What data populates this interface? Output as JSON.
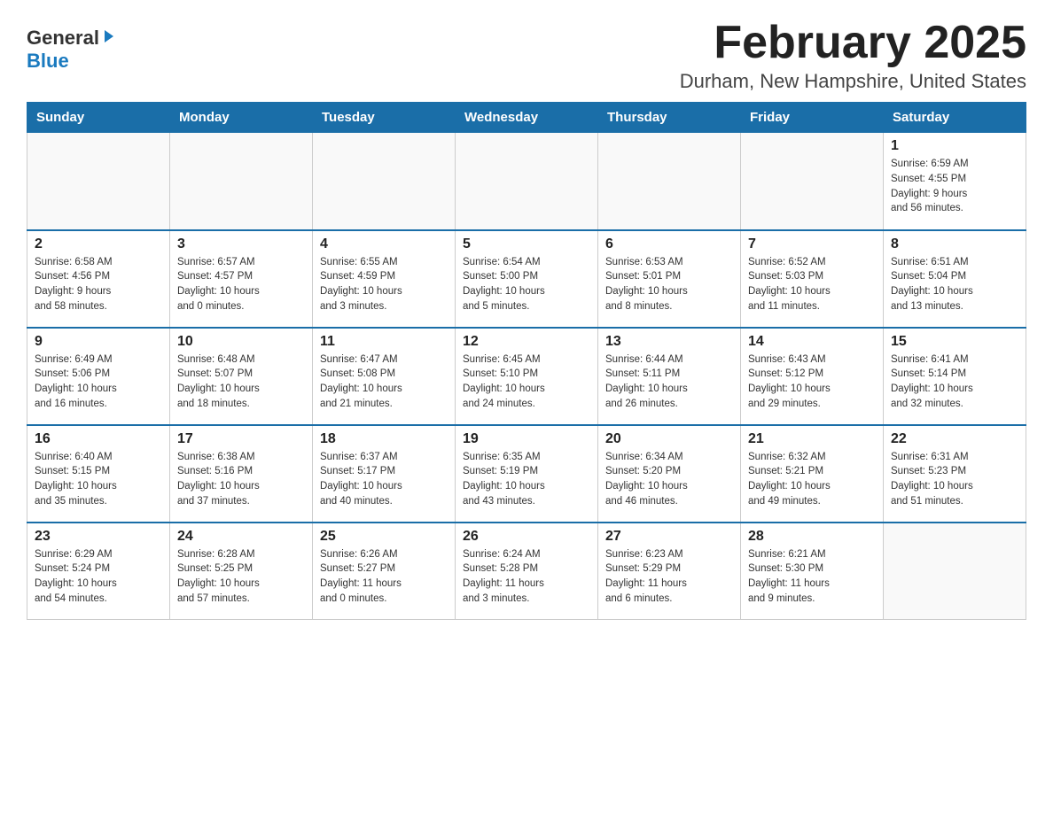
{
  "header": {
    "logo_general": "General",
    "logo_blue": "Blue",
    "month_title": "February 2025",
    "location": "Durham, New Hampshire, United States"
  },
  "days_of_week": [
    "Sunday",
    "Monday",
    "Tuesday",
    "Wednesday",
    "Thursday",
    "Friday",
    "Saturday"
  ],
  "weeks": [
    [
      {
        "day": "",
        "info": ""
      },
      {
        "day": "",
        "info": ""
      },
      {
        "day": "",
        "info": ""
      },
      {
        "day": "",
        "info": ""
      },
      {
        "day": "",
        "info": ""
      },
      {
        "day": "",
        "info": ""
      },
      {
        "day": "1",
        "info": "Sunrise: 6:59 AM\nSunset: 4:55 PM\nDaylight: 9 hours\nand 56 minutes."
      }
    ],
    [
      {
        "day": "2",
        "info": "Sunrise: 6:58 AM\nSunset: 4:56 PM\nDaylight: 9 hours\nand 58 minutes."
      },
      {
        "day": "3",
        "info": "Sunrise: 6:57 AM\nSunset: 4:57 PM\nDaylight: 10 hours\nand 0 minutes."
      },
      {
        "day": "4",
        "info": "Sunrise: 6:55 AM\nSunset: 4:59 PM\nDaylight: 10 hours\nand 3 minutes."
      },
      {
        "day": "5",
        "info": "Sunrise: 6:54 AM\nSunset: 5:00 PM\nDaylight: 10 hours\nand 5 minutes."
      },
      {
        "day": "6",
        "info": "Sunrise: 6:53 AM\nSunset: 5:01 PM\nDaylight: 10 hours\nand 8 minutes."
      },
      {
        "day": "7",
        "info": "Sunrise: 6:52 AM\nSunset: 5:03 PM\nDaylight: 10 hours\nand 11 minutes."
      },
      {
        "day": "8",
        "info": "Sunrise: 6:51 AM\nSunset: 5:04 PM\nDaylight: 10 hours\nand 13 minutes."
      }
    ],
    [
      {
        "day": "9",
        "info": "Sunrise: 6:49 AM\nSunset: 5:06 PM\nDaylight: 10 hours\nand 16 minutes."
      },
      {
        "day": "10",
        "info": "Sunrise: 6:48 AM\nSunset: 5:07 PM\nDaylight: 10 hours\nand 18 minutes."
      },
      {
        "day": "11",
        "info": "Sunrise: 6:47 AM\nSunset: 5:08 PM\nDaylight: 10 hours\nand 21 minutes."
      },
      {
        "day": "12",
        "info": "Sunrise: 6:45 AM\nSunset: 5:10 PM\nDaylight: 10 hours\nand 24 minutes."
      },
      {
        "day": "13",
        "info": "Sunrise: 6:44 AM\nSunset: 5:11 PM\nDaylight: 10 hours\nand 26 minutes."
      },
      {
        "day": "14",
        "info": "Sunrise: 6:43 AM\nSunset: 5:12 PM\nDaylight: 10 hours\nand 29 minutes."
      },
      {
        "day": "15",
        "info": "Sunrise: 6:41 AM\nSunset: 5:14 PM\nDaylight: 10 hours\nand 32 minutes."
      }
    ],
    [
      {
        "day": "16",
        "info": "Sunrise: 6:40 AM\nSunset: 5:15 PM\nDaylight: 10 hours\nand 35 minutes."
      },
      {
        "day": "17",
        "info": "Sunrise: 6:38 AM\nSunset: 5:16 PM\nDaylight: 10 hours\nand 37 minutes."
      },
      {
        "day": "18",
        "info": "Sunrise: 6:37 AM\nSunset: 5:17 PM\nDaylight: 10 hours\nand 40 minutes."
      },
      {
        "day": "19",
        "info": "Sunrise: 6:35 AM\nSunset: 5:19 PM\nDaylight: 10 hours\nand 43 minutes."
      },
      {
        "day": "20",
        "info": "Sunrise: 6:34 AM\nSunset: 5:20 PM\nDaylight: 10 hours\nand 46 minutes."
      },
      {
        "day": "21",
        "info": "Sunrise: 6:32 AM\nSunset: 5:21 PM\nDaylight: 10 hours\nand 49 minutes."
      },
      {
        "day": "22",
        "info": "Sunrise: 6:31 AM\nSunset: 5:23 PM\nDaylight: 10 hours\nand 51 minutes."
      }
    ],
    [
      {
        "day": "23",
        "info": "Sunrise: 6:29 AM\nSunset: 5:24 PM\nDaylight: 10 hours\nand 54 minutes."
      },
      {
        "day": "24",
        "info": "Sunrise: 6:28 AM\nSunset: 5:25 PM\nDaylight: 10 hours\nand 57 minutes."
      },
      {
        "day": "25",
        "info": "Sunrise: 6:26 AM\nSunset: 5:27 PM\nDaylight: 11 hours\nand 0 minutes."
      },
      {
        "day": "26",
        "info": "Sunrise: 6:24 AM\nSunset: 5:28 PM\nDaylight: 11 hours\nand 3 minutes."
      },
      {
        "day": "27",
        "info": "Sunrise: 6:23 AM\nSunset: 5:29 PM\nDaylight: 11 hours\nand 6 minutes."
      },
      {
        "day": "28",
        "info": "Sunrise: 6:21 AM\nSunset: 5:30 PM\nDaylight: 11 hours\nand 9 minutes."
      },
      {
        "day": "",
        "info": ""
      }
    ]
  ]
}
